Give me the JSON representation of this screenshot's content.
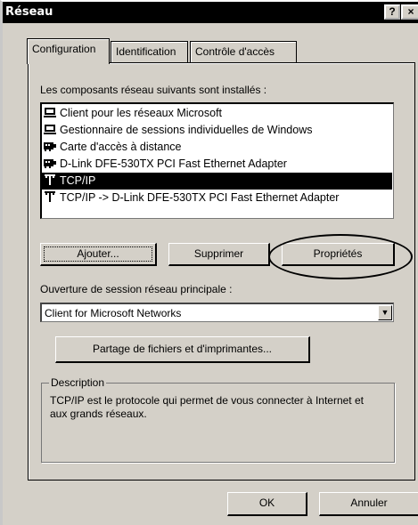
{
  "window": {
    "title": "Réseau",
    "help_button": "?",
    "close_button": "×"
  },
  "tabs": [
    {
      "label": "Configuration",
      "active": true
    },
    {
      "label": "Identification",
      "active": false
    },
    {
      "label": "Contrôle d'accès",
      "active": false
    }
  ],
  "components": {
    "label": "Les composants réseau suivants sont installés :",
    "items": [
      {
        "label": "Client pour les réseaux Microsoft",
        "icon": "client-icon",
        "selected": false
      },
      {
        "label": "Gestionnaire de sessions individuelles de Windows",
        "icon": "client-icon",
        "selected": false
      },
      {
        "label": "Carte d'accès à distance",
        "icon": "network-adapter-icon",
        "selected": false
      },
      {
        "label": "D-Link DFE-530TX PCI Fast Ethernet Adapter",
        "icon": "network-adapter-icon",
        "selected": false
      },
      {
        "label": "TCP/IP",
        "icon": "protocol-icon",
        "selected": true
      },
      {
        "label": "TCP/IP -> D-Link DFE-530TX PCI Fast Ethernet Adapter",
        "icon": "protocol-icon",
        "selected": false
      }
    ]
  },
  "buttons": {
    "add": "Ajouter...",
    "remove": "Supprimer",
    "properties": "Propriétés",
    "file_sharing": "Partage de fichiers et d'imprimantes...",
    "ok": "OK",
    "cancel": "Annuler"
  },
  "logon": {
    "label": "Ouverture de session réseau principale :",
    "value": "Client for Microsoft Networks"
  },
  "description": {
    "title": "Description",
    "text": "TCP/IP est le protocole qui permet de vous connecter à Internet et aux grands réseaux."
  }
}
